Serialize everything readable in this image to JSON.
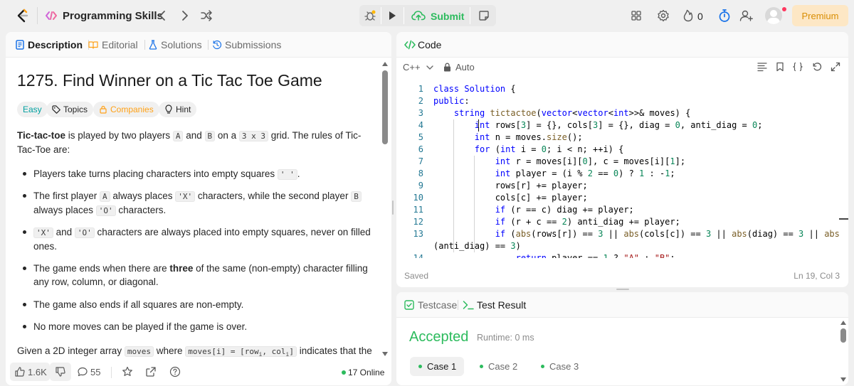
{
  "topbar": {
    "problem_list_label": "Programming Skills",
    "submit_label": "Submit",
    "fire_count": "0",
    "premium_label": "Premium",
    "colors": {
      "accent_green": "#2cbb5d",
      "premium_bg": "#fde7c5",
      "premium_text": "#d98e04"
    }
  },
  "left": {
    "tabs": [
      {
        "label": "Description"
      },
      {
        "label": "Editorial"
      },
      {
        "label": "Solutions"
      },
      {
        "label": "Submissions"
      }
    ],
    "title": "1275. Find Winner on a Tic Tac Toe Game",
    "chips": {
      "difficulty": "Easy",
      "topics": "Topics",
      "companies": "Companies",
      "hint": "Hint"
    },
    "intro": {
      "bold": "Tic-tac-toe",
      "t1": " is played by two players ",
      "c1": "A",
      "t2": " and ",
      "c2": "B",
      "t3": " on a ",
      "c3": "3 x 3",
      "t4": " grid. The rules of Tic-Tac-Toe are:"
    },
    "bullets": {
      "b1_text": "Players take turns placing characters into empty squares ",
      "b1_code": "' '",
      "b1_end": ".",
      "b2_t1": "The first player ",
      "b2_c1": "A",
      "b2_t2": " always places ",
      "b2_c2": "'X'",
      "b2_t3": " characters, while the second player ",
      "b2_c3": "B",
      "b2_t4": " always places ",
      "b2_c4": "'O'",
      "b2_t5": " characters.",
      "b3_c1": "'X'",
      "b3_t1": " and ",
      "b3_c2": "'O'",
      "b3_t2": " characters are always placed into empty squares, never on filled ones.",
      "b4_t1": "The game ends when there are ",
      "b4_bold": "three",
      "b4_t2": " of the same (non-empty) character filling any row, column, or diagonal.",
      "b5": "The game also ends if all squares are non-empty.",
      "b6": "No more moves can be played if the game is over."
    },
    "given": {
      "t1": "Given a 2D integer array ",
      "c1": "moves",
      "t2": " where ",
      "c2": "moves[i] = [row",
      "sub1": "i",
      "c3": ", col",
      "sub2": "i",
      "c4": "]",
      "t3": " indicates that the"
    },
    "footer": {
      "likes": "1.6K",
      "comments": "55",
      "online": "17 Online"
    }
  },
  "code": {
    "tab_label": "Code",
    "language": "C++",
    "mode": "Auto",
    "status_left": "Saved",
    "status_right": "Ln 19, Col 3",
    "line_numbers": [
      "1",
      "2",
      "3",
      "4",
      "5",
      "6",
      "7",
      "8",
      "9",
      "10",
      "11",
      "12",
      "13",
      "14"
    ]
  },
  "test": {
    "tabs": [
      {
        "label": "Testcase"
      },
      {
        "label": "Test Result"
      }
    ],
    "result": "Accepted",
    "runtime": "Runtime: 0 ms",
    "cases": [
      "Case 1",
      "Case 2",
      "Case 3"
    ]
  }
}
